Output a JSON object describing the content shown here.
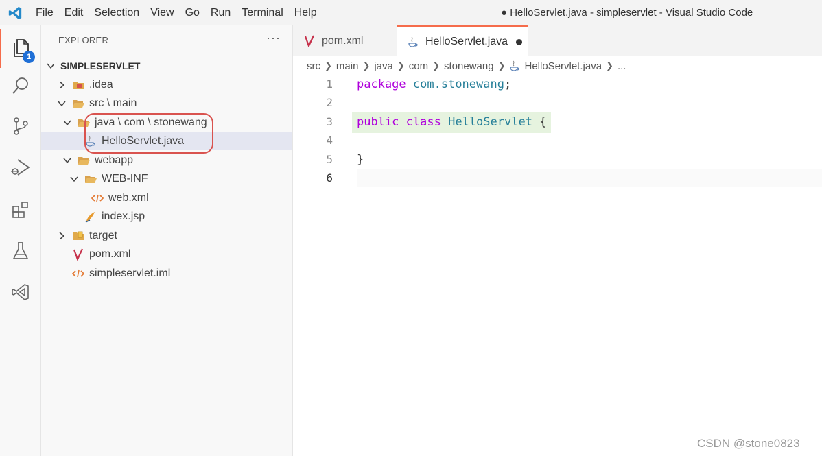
{
  "menu": {
    "items": [
      "File",
      "Edit",
      "Selection",
      "View",
      "Go",
      "Run",
      "Terminal",
      "Help"
    ]
  },
  "window_title": "● HelloServlet.java - simpleservlet - Visual Studio Code",
  "activity_bar": {
    "items": [
      "explorer",
      "search",
      "source-control",
      "run-debug",
      "extensions",
      "testing",
      "remote"
    ],
    "explorer_badge": "1"
  },
  "sidebar": {
    "title": "EXPLORER",
    "more": "···",
    "root": "SIMPLESERVLET",
    "tree": [
      {
        "label": ".idea"
      },
      {
        "label": "src \\ main"
      },
      {
        "label": "java \\ com \\ stonewang"
      },
      {
        "label": "HelloServlet.java"
      },
      {
        "label": "webapp"
      },
      {
        "label": "WEB-INF"
      },
      {
        "label": "web.xml"
      },
      {
        "label": "index.jsp"
      },
      {
        "label": "target"
      },
      {
        "label": "pom.xml"
      },
      {
        "label": "simpleservlet.iml"
      }
    ]
  },
  "tabs": [
    {
      "label": "pom.xml"
    },
    {
      "label": "HelloServlet.java"
    }
  ],
  "breadcrumb": [
    "src",
    "main",
    "java",
    "com",
    "stonewang",
    "HelloServlet.java",
    "..."
  ],
  "code": {
    "line_numbers": [
      "1",
      "2",
      "3",
      "4",
      "5",
      "6"
    ],
    "line1_kw": "package",
    "line1_pkg": "com.stonewang",
    "line1_end": ";",
    "line3_kw1": "public",
    "line3_kw2": "class",
    "line3_cls": "HelloServlet",
    "line3_end": " {",
    "line5": "}"
  },
  "watermark": "CSDN @stone0823",
  "colors": {
    "accent": "#f56c4b",
    "badge": "#1f6fd6",
    "highlight_oval": "#d9534f"
  }
}
